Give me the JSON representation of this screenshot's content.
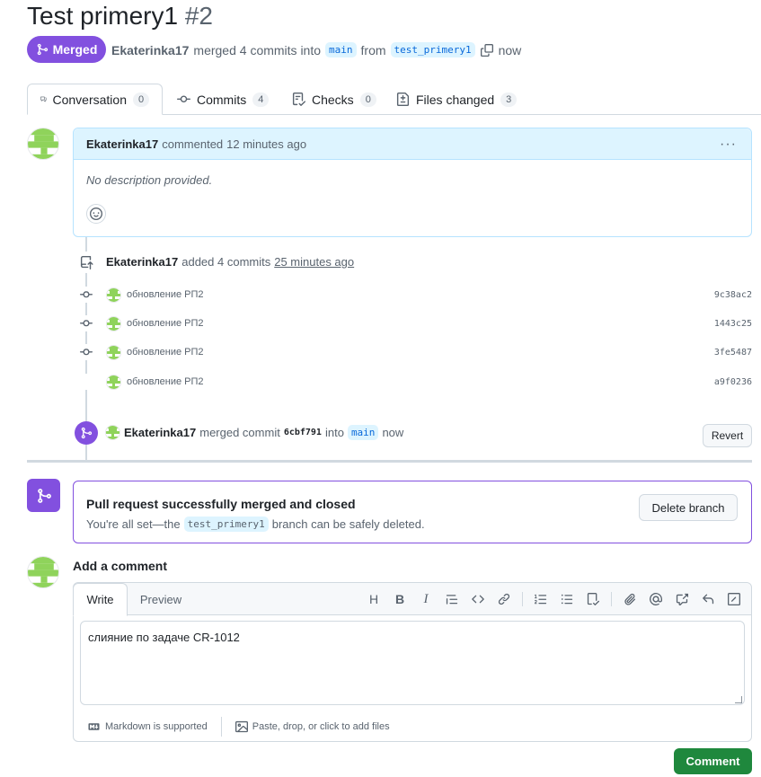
{
  "header": {
    "title": "Test primery1",
    "number": "#2",
    "state_label": "Merged",
    "author": "Ekaterinka17",
    "merged_text": "merged 4 commits into",
    "base_branch": "main",
    "from_text": "from",
    "head_branch": "test_primery1",
    "time": "now"
  },
  "tabs": [
    {
      "label": "Conversation",
      "count": "0",
      "icon": "comment-icon"
    },
    {
      "label": "Commits",
      "count": "4",
      "icon": "commit-icon"
    },
    {
      "label": "Checks",
      "count": "0",
      "icon": "checklist-icon"
    },
    {
      "label": "Files changed",
      "count": "3",
      "icon": "file-diff-icon"
    }
  ],
  "comment": {
    "author": "Ekaterinka17",
    "action": "commented",
    "time": "12 minutes ago",
    "body": "No description provided."
  },
  "commits_event": {
    "author": "Ekaterinka17",
    "action": "added 4 commits",
    "time": "25 minutes ago",
    "commits": [
      {
        "message": "обновление РП2",
        "sha": "9c38ac2"
      },
      {
        "message": "обновление РП2",
        "sha": "1443c25"
      },
      {
        "message": "обновление РП2",
        "sha": "3fe5487"
      },
      {
        "message": "обновление РП2",
        "sha": "a9f0236"
      }
    ]
  },
  "merge_event": {
    "author": "Ekaterinka17",
    "action": "merged commit",
    "sha": "6cbf791",
    "into": "into",
    "branch": "main",
    "time": "now",
    "revert_label": "Revert"
  },
  "merged_box": {
    "title": "Pull request successfully merged and closed",
    "sub_prefix": "You're all set—the",
    "branch": "test_primery1",
    "sub_suffix": "branch can be safely deleted.",
    "delete_label": "Delete branch"
  },
  "add_comment": {
    "title": "Add a comment",
    "tab_write": "Write",
    "tab_preview": "Preview",
    "text": "слияние по задаче CR-1012",
    "markdown_note": "Markdown is supported",
    "attach_note": "Paste, drop, or click to add files",
    "submit_label": "Comment"
  },
  "colors": {
    "merged_purple": "#8250df",
    "comment_green": "#1f883d",
    "link_blue": "#0969da"
  }
}
